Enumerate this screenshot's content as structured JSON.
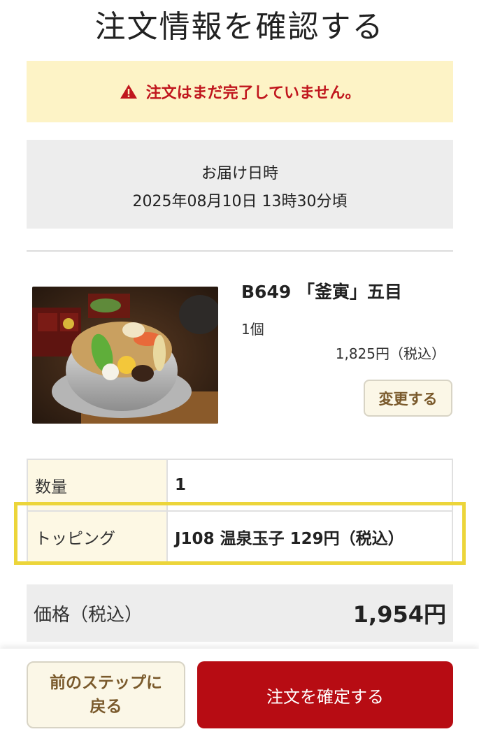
{
  "page": {
    "title": "注文情報を確認する"
  },
  "warning": {
    "text": "注文はまだ完了していません。",
    "color": "#c0161d"
  },
  "delivery": {
    "label": "お届け日時",
    "value": "2025年08月10日 13時30分頃"
  },
  "product": {
    "name": "B649 「釜寅」五目",
    "quantity": "1個",
    "price": "1,825円（税込）",
    "change_button": "変更する",
    "image_icon": "kamameshi-photo"
  },
  "details": {
    "rows": [
      {
        "key": "数量",
        "value": "1"
      },
      {
        "key": "トッピング",
        "value": "J108 温泉玉子 129円（税込）"
      }
    ]
  },
  "total": {
    "label": "価格（税込）",
    "value": "1,954円"
  },
  "footer": {
    "back_button": "前のステップに戻る",
    "confirm_button": "注文を確定する",
    "accent_color": "#b70c13"
  }
}
